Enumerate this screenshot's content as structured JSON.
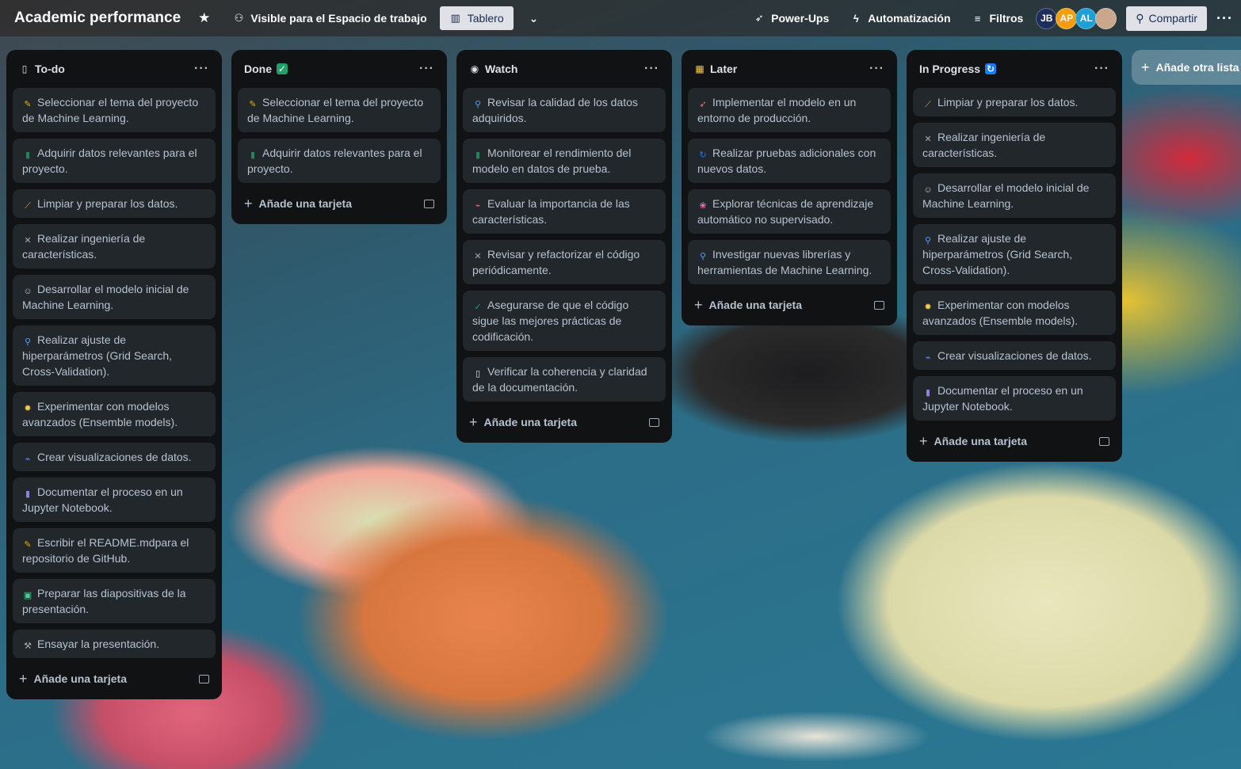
{
  "topbar": {
    "board_title": "Academic performance",
    "visibility_label": "Visible para el Espacio de trabajo",
    "view_label": "Tablero",
    "powerups_label": "Power-Ups",
    "automation_label": "Automatización",
    "filters_label": "Filtros",
    "share_label": "Compartir",
    "avatars": [
      {
        "initials": "JB",
        "color": "#1d2d5c"
      },
      {
        "initials": "AP",
        "color": "#f59e0b"
      },
      {
        "initials": "AL",
        "color": "#1f9fd8"
      },
      {
        "initials": "",
        "color": "#c8a78a"
      }
    ]
  },
  "add_card_label": "Añade una tarjeta",
  "add_list_label": "Añade otra lista",
  "lists": [
    {
      "title": "To-do",
      "cards": [
        "Seleccionar el tema del proyecto de Machine Learning.",
        "Adquirir datos relevantes para el proyecto.",
        "Limpiar y preparar los datos.",
        "Realizar ingeniería de características.",
        "Desarrollar el modelo inicial de Machine Learning.",
        "Realizar ajuste de hiperparámetros (Grid Search, Cross-Validation).",
        "Experimentar con modelos avanzados (Ensemble models).",
        "Crear visualizaciones de datos.",
        "Documentar el proceso en un Jupyter Notebook.",
        "Escribir el README.mdpara el repositorio de GitHub.",
        "Preparar las diapositivas de la presentación.",
        "Ensayar la presentación."
      ]
    },
    {
      "title": "Done",
      "cards": [
        "Seleccionar el tema del proyecto de Machine Learning.",
        "Adquirir datos relevantes para el proyecto."
      ]
    },
    {
      "title": "Watch",
      "cards": [
        "Revisar la calidad de los datos adquiridos.",
        "Monitorear el rendimiento del modelo en datos de prueba.",
        "Evaluar la importancia de las características.",
        "Revisar y refactorizar el código periódicamente.",
        "Asegurarse de que el código sigue las mejores prácticas de codificación.",
        "Verificar la coherencia y claridad de la documentación."
      ]
    },
    {
      "title": "Later",
      "cards": [
        "Implementar el modelo en un entorno de producción.",
        "Realizar pruebas adicionales con nuevos datos.",
        "Explorar técnicas de aprendizaje automático no supervisado.",
        "Investigar nuevas librerías y herramientas de Machine Learning."
      ]
    },
    {
      "title": "In Progress",
      "cards": [
        "Limpiar y preparar los datos.",
        "Realizar ingeniería de características.",
        "Desarrollar el modelo inicial de Machine Learning.",
        "Realizar ajuste de hiperparámetros (Grid Search, Cross-Validation).",
        "Experimentar con modelos avanzados (Ensemble models).",
        "Crear visualizaciones de datos.",
        "Documentar el proceso en un Jupyter Notebook."
      ]
    }
  ]
}
